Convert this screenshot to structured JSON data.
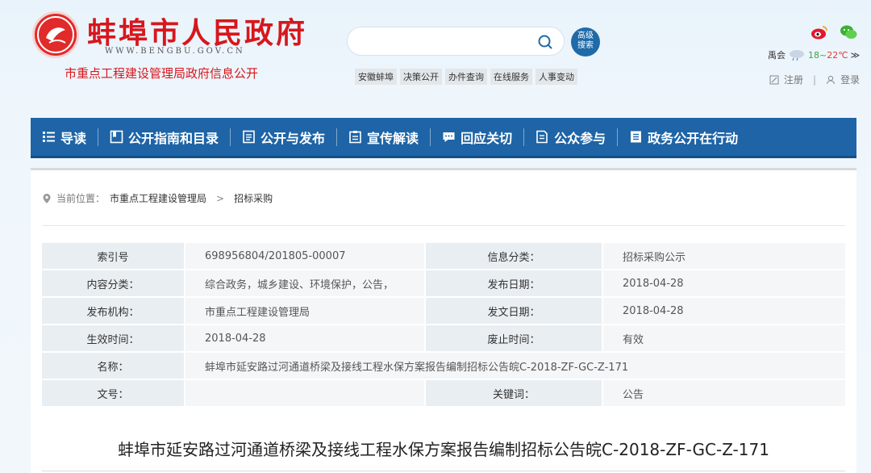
{
  "header": {
    "site_title": "蚌埠市人民政府",
    "domain": "WWW.BENGBU.GOV.CN",
    "dept_title": "市重点工程建设管理局政府信息公开",
    "search_placeholder": "",
    "adv_search_line1": "高级",
    "adv_search_line2": "搜索",
    "quick_links": [
      "安徽蚌埠",
      "决策公开",
      "办件查询",
      "在线服务",
      "人事变动"
    ],
    "weather": {
      "city": "禹会",
      "temp_low": "18",
      "tilde": "~",
      "temp_high": "22",
      "unit": "℃",
      "more": "≫"
    },
    "register": "注册",
    "login": "登录",
    "separator": "|"
  },
  "nav": {
    "items": [
      "导读",
      "公开指南和目录",
      "公开与发布",
      "宣传解读",
      "回应关切",
      "公众参与",
      "政务公开在行动"
    ]
  },
  "breadcrumb": {
    "current_label": "当前位置：",
    "crumb1": "市重点工程建设管理局",
    "arrow": ">",
    "crumb2": "招标采购"
  },
  "info": {
    "index_no_label": "索引号",
    "index_no": "698956804/201805-00007",
    "category_label": "信息分类：",
    "category": "招标采购公示",
    "content_class_label": "内容分类：",
    "content_class": "综合政务，城乡建设、环境保护，公告，",
    "publish_date_label": "发布日期：",
    "publish_date": "2018-04-28",
    "publisher_label": "发布机构：",
    "publisher": "市重点工程建设管理局",
    "doc_date_label": "发文日期：",
    "doc_date": "2018-04-28",
    "effective_label": "生效时间：",
    "effective": "2018-04-28",
    "expire_label": "废止时间：",
    "expire": "有效",
    "name_label": "名称：",
    "name": "蚌埠市延安路过河通道桥梁及接线工程水保方案报告编制招标公告皖C-2018-ZF-GC-Z-171",
    "doc_no_label": "文号：",
    "doc_no": "",
    "keywords_label": "关键词：",
    "keywords": "公告"
  },
  "article": {
    "title": "蚌埠市延安路过河通道桥梁及接线工程水保方案报告编制招标公告皖C-2018-ZF-GC-Z-171"
  },
  "colors": {
    "brand_red": "#d6171d",
    "nav_blue": "#1e64a6"
  }
}
